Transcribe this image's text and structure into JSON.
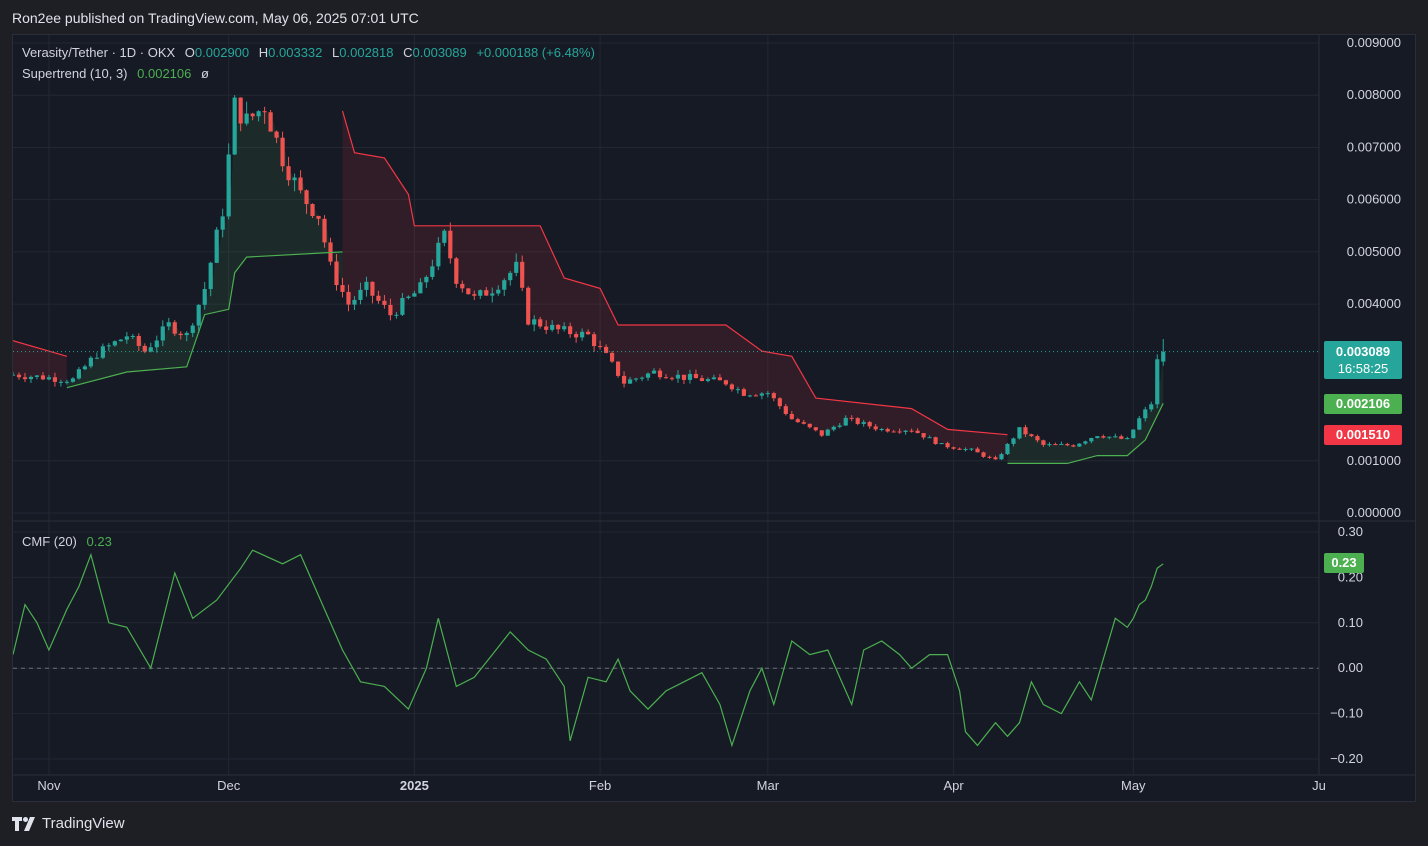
{
  "header": {
    "published": "Ron2ee published on TradingView.com, May 06, 2025 07:01 UTC"
  },
  "legend": {
    "symbol": "Verasity/Tether · 1D · OKX",
    "o_label": "O",
    "o_value": "0.002900",
    "h_label": "H",
    "h_value": "0.003332",
    "l_label": "L",
    "l_value": "0.002818",
    "c_label": "C",
    "c_value": "0.003089",
    "change": "+0.000188 (+6.48%)",
    "supertrend_label": "Supertrend (10, 3)",
    "supertrend_value": "0.002106",
    "supertrend_extra": "ø",
    "cmf_label": "CMF (20)",
    "cmf_value": "0.23"
  },
  "badges": {
    "price": "0.003089",
    "countdown": "16:58:25",
    "supertrend_up": "0.002106",
    "supertrend_down": "0.001510",
    "cmf": "0.23"
  },
  "colors": {
    "up": "#26a69a",
    "down": "#ef5350",
    "supertrend_up": "#4caf50",
    "supertrend_down": "#f23645",
    "cmf_line": "#4caf50",
    "background": "#161a25"
  },
  "footer": {
    "brand": "TradingView"
  },
  "chart_data": [
    {
      "type": "candlestick",
      "title": "Verasity/Tether · 1D · OKX",
      "y_ticks": [
        "0.009000",
        "0.008000",
        "0.007000",
        "0.006000",
        "0.005000",
        "0.004000",
        "0.001000",
        "0.000000"
      ],
      "ylim": [
        0,
        0.009
      ],
      "x_ticks": [
        "Nov",
        "Dec",
        "2025",
        "Feb",
        "Mar",
        "Apr",
        "May",
        "Ju"
      ],
      "x_tick_dates": [
        "2024-11-01",
        "2024-12-01",
        "2025-01-01",
        "2025-02-01",
        "2025-03-01",
        "2025-04-01",
        "2025-05-01",
        "2025-06-01"
      ],
      "xlim": [
        "2024-10-26",
        "2025-06-01"
      ],
      "grid": true,
      "anchors": [
        [
          "2024-10-26",
          0.00265
        ],
        [
          "2024-11-05",
          0.00255
        ],
        [
          "2024-11-09",
          0.00305
        ],
        [
          "2024-11-14",
          0.0034
        ],
        [
          "2024-11-17",
          0.0031
        ],
        [
          "2024-11-21",
          0.0036
        ],
        [
          "2024-11-24",
          0.0034
        ],
        [
          "2024-11-27",
          0.0043
        ],
        [
          "2024-11-30",
          0.0058
        ],
        [
          "2024-12-02",
          0.0078
        ],
        [
          "2024-12-04",
          0.0075
        ],
        [
          "2024-12-07",
          0.0078
        ],
        [
          "2024-12-10",
          0.0068
        ],
        [
          "2024-12-13",
          0.0061
        ],
        [
          "2024-12-16",
          0.0057
        ],
        [
          "2024-12-18",
          0.0047
        ],
        [
          "2024-12-21",
          0.004
        ],
        [
          "2024-12-24",
          0.0043
        ],
        [
          "2024-12-28",
          0.0038
        ],
        [
          "2025-01-02",
          0.0043
        ],
        [
          "2025-01-06",
          0.0053
        ],
        [
          "2025-01-08",
          0.0045
        ],
        [
          "2025-01-11",
          0.0041
        ],
        [
          "2025-01-14",
          0.0043
        ],
        [
          "2025-01-18",
          0.0047
        ],
        [
          "2025-01-20",
          0.0037
        ],
        [
          "2025-01-25",
          0.0035
        ],
        [
          "2025-01-30",
          0.0034
        ],
        [
          "2025-02-02",
          0.003
        ],
        [
          "2025-02-05",
          0.0025
        ],
        [
          "2025-02-10",
          0.0027
        ],
        [
          "2025-02-15",
          0.0026
        ],
        [
          "2025-02-22",
          0.0025
        ],
        [
          "2025-02-25",
          0.0023
        ],
        [
          "2025-03-01",
          0.0023
        ],
        [
          "2025-03-05",
          0.0018
        ],
        [
          "2025-03-10",
          0.0015
        ],
        [
          "2025-03-14",
          0.0018
        ],
        [
          "2025-03-20",
          0.0016
        ],
        [
          "2025-03-25",
          0.0016
        ],
        [
          "2025-03-30",
          0.0013
        ],
        [
          "2025-04-04",
          0.0012
        ],
        [
          "2025-04-08",
          0.001
        ],
        [
          "2025-04-12",
          0.0016
        ],
        [
          "2025-04-16",
          0.0013
        ],
        [
          "2025-04-21",
          0.0013
        ],
        [
          "2025-04-25",
          0.0015
        ],
        [
          "2025-04-30",
          0.0014
        ],
        [
          "2025-05-02",
          0.0018
        ],
        [
          "2025-05-04",
          0.0021
        ],
        [
          "2025-05-05",
          0.0029
        ],
        [
          "2025-05-06",
          0.003089
        ]
      ],
      "last": {
        "date": "2025-05-06",
        "open": 0.0029,
        "high": 0.003332,
        "low": 0.002818,
        "close": 0.003089
      },
      "supertrend": [
        {
          "trend": "down",
          "points": [
            [
              "2024-10-26",
              0.0033
            ],
            [
              "2024-11-04",
              0.003
            ]
          ]
        },
        {
          "trend": "up",
          "points": [
            [
              "2024-11-04",
              0.0024
            ],
            [
              "2024-11-14",
              0.0027
            ],
            [
              "2024-11-24",
              0.0028
            ],
            [
              "2024-11-27",
              0.0038
            ],
            [
              "2024-12-01",
              0.0039
            ],
            [
              "2024-12-02",
              0.0046
            ],
            [
              "2024-12-04",
              0.0049
            ],
            [
              "2024-12-20",
              0.005
            ]
          ]
        },
        {
          "trend": "down",
          "points": [
            [
              "2024-12-20",
              0.0077
            ],
            [
              "2024-12-22",
              0.0069
            ],
            [
              "2024-12-27",
              0.0068
            ],
            [
              "2024-12-31",
              0.0061
            ],
            [
              "2025-01-01",
              0.0055
            ],
            [
              "2025-01-22",
              0.0055
            ],
            [
              "2025-01-26",
              0.0045
            ],
            [
              "2025-02-01",
              0.0043
            ],
            [
              "2025-02-04",
              0.0036
            ],
            [
              "2025-02-22",
              0.0036
            ],
            [
              "2025-02-28",
              0.0031
            ],
            [
              "2025-03-05",
              0.003
            ],
            [
              "2025-03-09",
              0.0022
            ],
            [
              "2025-03-25",
              0.002
            ],
            [
              "2025-03-31",
              0.0016
            ],
            [
              "2025-04-10",
              0.0015
            ]
          ]
        },
        {
          "trend": "up",
          "points": [
            [
              "2025-04-10",
              0.00095
            ],
            [
              "2025-04-20",
              0.00095
            ],
            [
              "2025-04-25",
              0.0011
            ],
            [
              "2025-04-30",
              0.0011
            ],
            [
              "2025-05-03",
              0.0014
            ],
            [
              "2025-05-06",
              0.0021
            ]
          ]
        }
      ]
    },
    {
      "type": "line",
      "title": "CMF (20)",
      "y_ticks": [
        "0.30",
        "0.20",
        "0.10",
        "0.00",
        "−0.10",
        "−0.20"
      ],
      "ylim": [
        -0.2,
        0.3
      ],
      "zero_line": true,
      "series": [
        {
          "name": "CMF (20)",
          "points": [
            [
              "2024-10-26",
              0.03
            ],
            [
              "2024-10-28",
              0.14
            ],
            [
              "2024-10-30",
              0.1
            ],
            [
              "2024-11-01",
              0.04
            ],
            [
              "2024-11-04",
              0.13
            ],
            [
              "2024-11-06",
              0.18
            ],
            [
              "2024-11-08",
              0.25
            ],
            [
              "2024-11-11",
              0.1
            ],
            [
              "2024-11-14",
              0.09
            ],
            [
              "2024-11-18",
              0.0
            ],
            [
              "2024-11-22",
              0.21
            ],
            [
              "2024-11-25",
              0.11
            ],
            [
              "2024-11-29",
              0.15
            ],
            [
              "2024-12-03",
              0.22
            ],
            [
              "2024-12-05",
              0.26
            ],
            [
              "2024-12-10",
              0.23
            ],
            [
              "2024-12-13",
              0.25
            ],
            [
              "2024-12-17",
              0.13
            ],
            [
              "2024-12-20",
              0.04
            ],
            [
              "2024-12-23",
              -0.03
            ],
            [
              "2024-12-27",
              -0.04
            ],
            [
              "2024-12-31",
              -0.09
            ],
            [
              "2025-01-03",
              0.0
            ],
            [
              "2025-01-05",
              0.11
            ],
            [
              "2025-01-08",
              -0.04
            ],
            [
              "2025-01-11",
              -0.02
            ],
            [
              "2025-01-14",
              0.03
            ],
            [
              "2025-01-17",
              0.08
            ],
            [
              "2025-01-20",
              0.04
            ],
            [
              "2025-01-23",
              0.02
            ],
            [
              "2025-01-26",
              -0.04
            ],
            [
              "2025-01-27",
              -0.16
            ],
            [
              "2025-01-30",
              -0.02
            ],
            [
              "2025-02-02",
              -0.03
            ],
            [
              "2025-02-04",
              0.02
            ],
            [
              "2025-02-06",
              -0.05
            ],
            [
              "2025-02-09",
              -0.09
            ],
            [
              "2025-02-12",
              -0.05
            ],
            [
              "2025-02-15",
              -0.03
            ],
            [
              "2025-02-18",
              -0.01
            ],
            [
              "2025-02-21",
              -0.08
            ],
            [
              "2025-02-23",
              -0.17
            ],
            [
              "2025-02-26",
              -0.05
            ],
            [
              "2025-02-28",
              0.0
            ],
            [
              "2025-03-02",
              -0.08
            ],
            [
              "2025-03-05",
              0.06
            ],
            [
              "2025-03-08",
              0.03
            ],
            [
              "2025-03-11",
              0.04
            ],
            [
              "2025-03-13",
              -0.02
            ],
            [
              "2025-03-15",
              -0.08
            ],
            [
              "2025-03-17",
              0.04
            ],
            [
              "2025-03-20",
              0.06
            ],
            [
              "2025-03-23",
              0.03
            ],
            [
              "2025-03-25",
              0.0
            ],
            [
              "2025-03-28",
              0.03
            ],
            [
              "2025-03-31",
              0.03
            ],
            [
              "2025-04-02",
              -0.05
            ],
            [
              "2025-04-03",
              -0.14
            ],
            [
              "2025-04-05",
              -0.17
            ],
            [
              "2025-04-08",
              -0.12
            ],
            [
              "2025-04-10",
              -0.15
            ],
            [
              "2025-04-12",
              -0.12
            ],
            [
              "2025-04-14",
              -0.03
            ],
            [
              "2025-04-16",
              -0.08
            ],
            [
              "2025-04-19",
              -0.1
            ],
            [
              "2025-04-22",
              -0.03
            ],
            [
              "2025-04-24",
              -0.07
            ],
            [
              "2025-04-26",
              0.02
            ],
            [
              "2025-04-28",
              0.11
            ],
            [
              "2025-04-30",
              0.09
            ],
            [
              "2025-05-01",
              0.11
            ],
            [
              "2025-05-02",
              0.14
            ],
            [
              "2025-05-03",
              0.15
            ],
            [
              "2025-05-04",
              0.18
            ],
            [
              "2025-05-05",
              0.22
            ],
            [
              "2025-05-06",
              0.23
            ]
          ]
        }
      ]
    }
  ]
}
